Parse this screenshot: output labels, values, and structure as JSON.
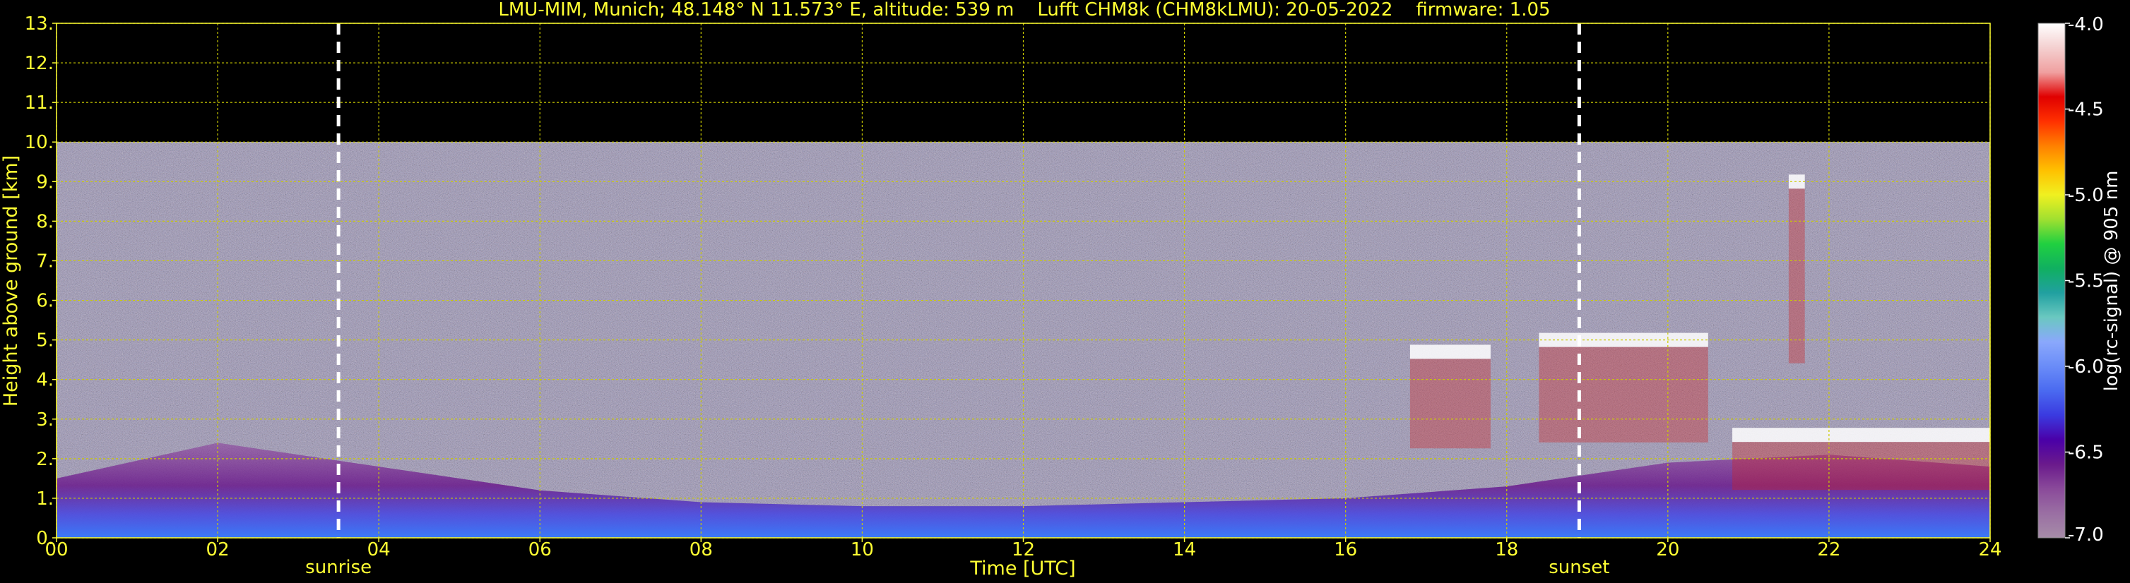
{
  "chart_data": {
    "type": "heatmap",
    "title": "LMU-MIM, Munich; 48.148° N 11.573° E, altitude: 539 m    Lufft CHM8k (CHM8kLMU): 20-05-2022    firmware: 1.05",
    "xlabel": "Time [UTC]",
    "ylabel": "Height above ground [km]",
    "xlim": [
      0,
      24
    ],
    "ylim": [
      0,
      13
    ],
    "x_ticks": [
      "00",
      "02",
      "04",
      "06",
      "08",
      "10",
      "12",
      "14",
      "16",
      "18",
      "20",
      "22",
      "24"
    ],
    "y_ticks": [
      "0.",
      "1.",
      "2.",
      "3.",
      "4.",
      "5.",
      "6.",
      "7.",
      "8.",
      "9.",
      "10.",
      "11.",
      "12.",
      "13."
    ],
    "grid": true,
    "data_top_km": 10,
    "events": [
      {
        "label": "sunrise",
        "time": 3.5
      },
      {
        "label": "sunset",
        "time": 18.9
      }
    ],
    "colorbar": {
      "label": "log(rc-signal) @ 905 nm",
      "range": [
        -7.0,
        -4.0
      ],
      "ticks": [
        "-4.0",
        "-4.5",
        "-5.0",
        "-5.5",
        "-6.0",
        "-6.5",
        "-7.0"
      ],
      "colors": [
        "#a68ca8",
        "#9a6fa3",
        "#8a4a9a",
        "#6a1a8c",
        "#4a00a8",
        "#3a3ae0",
        "#4a6af0",
        "#6a8cf8",
        "#8aa8fc",
        "#6ac8c0",
        "#20a0a0",
        "#10b060",
        "#20d040",
        "#a0e030",
        "#f0f020",
        "#ffc000",
        "#ff8000",
        "#ff3000",
        "#e00000",
        "#f0a0a0",
        "#f4d0d0",
        "#ffffff"
      ]
    },
    "layers": [
      {
        "name": "boundary layer",
        "t_start": 0,
        "t_end": 24,
        "height_km": [
          1.5,
          2.4,
          1.8,
          1.2,
          0.9,
          0.8,
          0.8,
          0.9,
          1.0,
          1.3,
          1.9,
          2.1,
          1.8
        ]
      },
      {
        "name": "cloud",
        "t_start": 16.8,
        "t_end": 17.8,
        "height_km": 4.7
      },
      {
        "name": "cloud",
        "t_start": 18.4,
        "t_end": 20.5,
        "height_km": 5.0
      },
      {
        "name": "cloud",
        "t_start": 20.8,
        "t_end": 24,
        "height_km": 2.6
      },
      {
        "name": "cloud",
        "t_start": 21.5,
        "t_end": 21.7,
        "height_km": 9.0
      }
    ]
  }
}
